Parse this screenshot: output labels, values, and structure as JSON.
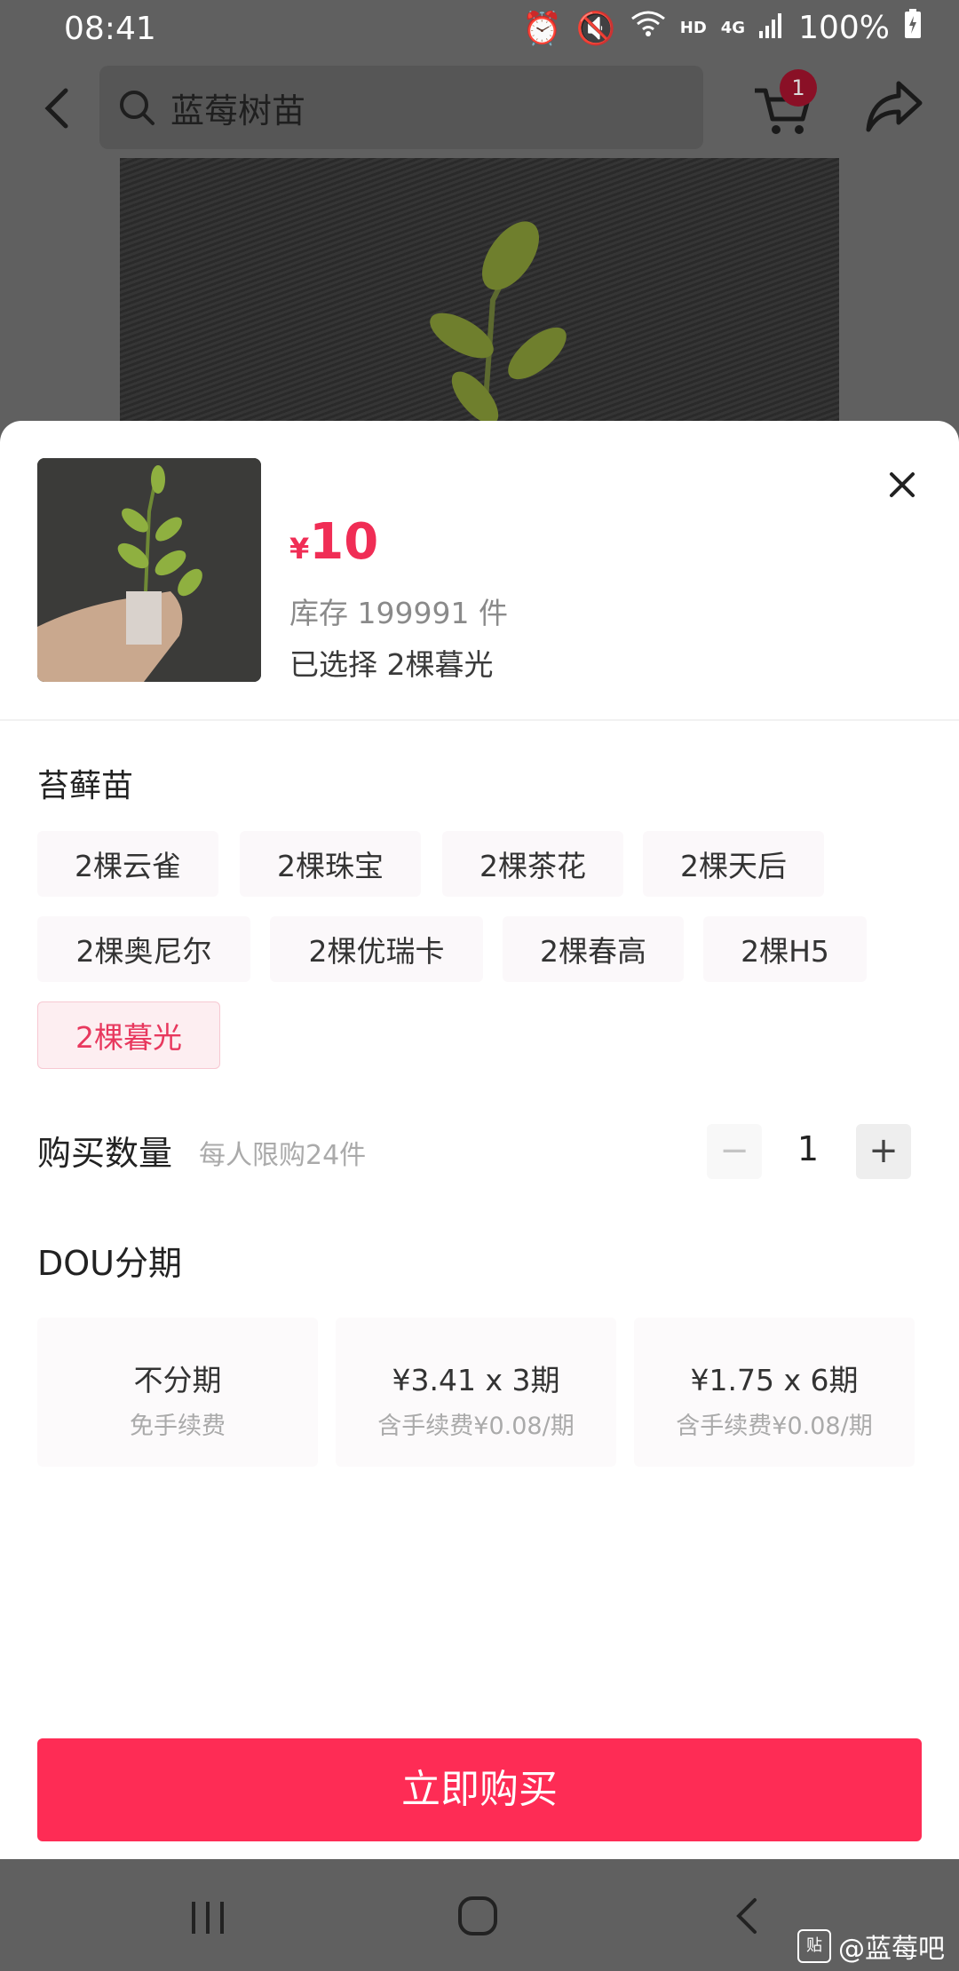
{
  "status_bar": {
    "time": "08:41",
    "hd": "HD",
    "net": "4G",
    "battery": "100%"
  },
  "top_bar": {
    "search_text": "蓝莓树苗",
    "cart_badge": "1"
  },
  "product": {
    "currency": "¥",
    "price": "10",
    "stock": "库存 199991 件",
    "selected": "已选择  2棵暮光"
  },
  "options": {
    "title": "苔藓苗",
    "items": [
      "2棵云雀",
      "2棵珠宝",
      "2棵茶花",
      "2棵天后",
      "2棵奥尼尔",
      "2棵优瑞卡",
      "2棵春高",
      "2棵H5",
      "2棵暮光"
    ],
    "selected_index": 8
  },
  "quantity": {
    "label": "购买数量",
    "limit": "每人限购24件",
    "minus": "−",
    "value": "1",
    "plus": "+"
  },
  "installments": {
    "title": "DOU分期",
    "plans": [
      {
        "main": "不分期",
        "sub": "免手续费"
      },
      {
        "main": "¥3.41 x 3期",
        "sub": "含手续费¥0.08/期"
      },
      {
        "main": "¥1.75 x 6期",
        "sub": "含手续费¥0.08/期"
      }
    ]
  },
  "buy_button": "立即购买",
  "watermark": {
    "logo": "贴",
    "text": "@蓝莓吧"
  },
  "colors": {
    "accent": "#fe2c55",
    "price": "#f02d55"
  }
}
